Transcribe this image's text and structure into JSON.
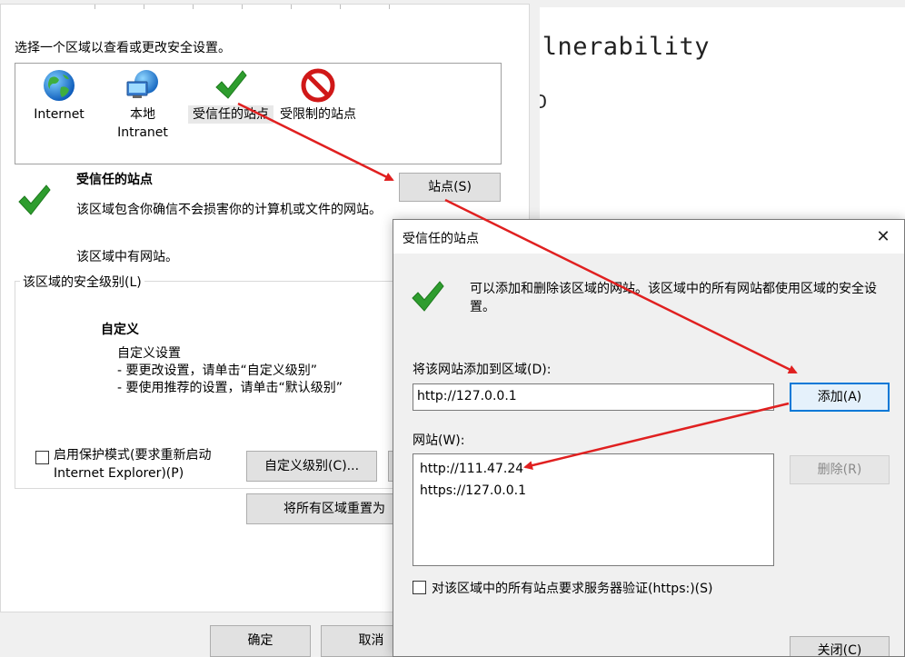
{
  "background_doc": {
    "line1": "ulnerability",
    "line2": "D"
  },
  "internet_options": {
    "instruction": "选择一个区域以查看或更改安全设置。",
    "zones": [
      {
        "label": "Internet",
        "icon": "globe-icon"
      },
      {
        "label": "本地\nIntranet",
        "icon": "intranet-icon"
      },
      {
        "label": "受信任的站点",
        "icon": "checkmark-icon"
      },
      {
        "label": "受限制的站点",
        "icon": "prohibited-icon"
      }
    ],
    "selected_zone": {
      "title": "受信任的站点",
      "description": "该区域包含你确信不会损害你的计算机或文件的网站。",
      "has_sites": "该区域中有网站。",
      "sites_button": "站点(S)"
    },
    "security_level": {
      "group_label": "该区域的安全级别(L)",
      "level_name": "自定义",
      "level_desc": "自定义设置\n- 要更改设置，请单击“自定义级别”\n- 要使用推荐的设置，请单击“默认级别”"
    },
    "protected_mode_label": "启用保护模式(要求重新启动\nInternet Explorer)(P)",
    "custom_level_button": "自定义级别(C)...",
    "reset_all_button": "将所有区域重置为",
    "ok_button": "确定",
    "cancel_button": "取消"
  },
  "trusted_sites_dialog": {
    "title": "受信任的站点",
    "intro": "可以添加和删除该区域的网站。该区域中的所有网站都使用区域的安全设置。",
    "add_label": "将该网站添加到区域(D):",
    "add_value": "http://127.0.0.1",
    "add_button": "添加(A)",
    "sites_label": "网站(W):",
    "sites": [
      "http://111.47.24",
      "https://127.0.0.1"
    ],
    "remove_button": "删除(R)",
    "require_https_label": "对该区域中的所有站点要求服务器验证(https:)(S)",
    "close_button": "关闭(C)"
  },
  "colors": {
    "annotation_arrow": "#e02020",
    "focus_border": "#0078d7",
    "check_green": "#2e9d2e"
  }
}
